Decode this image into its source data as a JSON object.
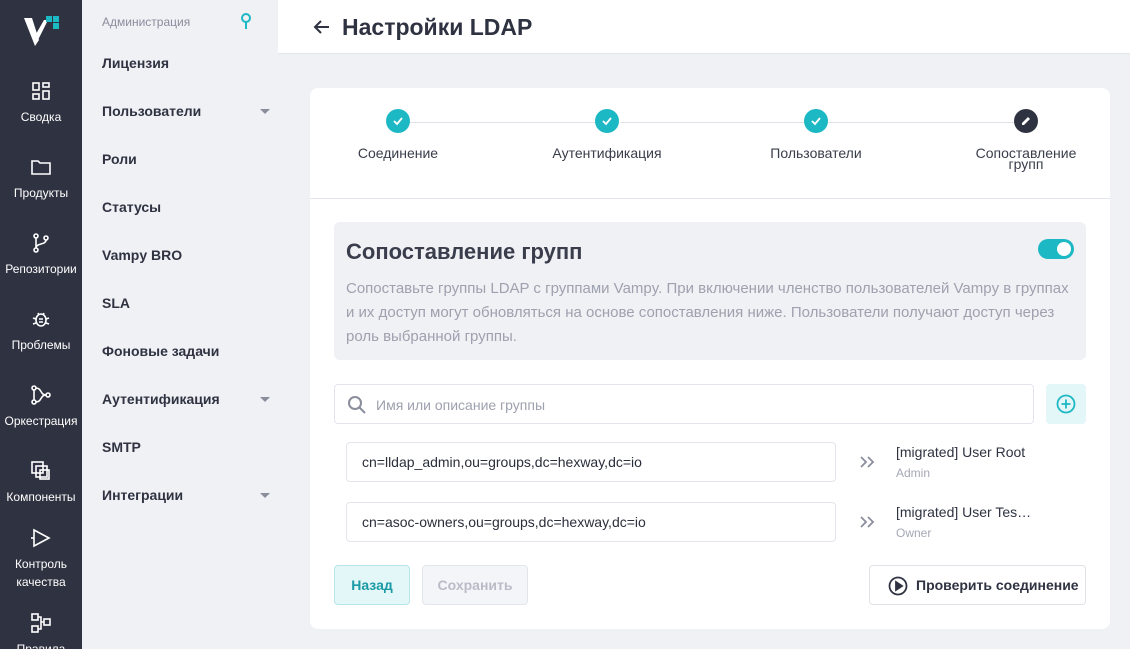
{
  "rail": {
    "items": [
      {
        "label": "Сводка",
        "icon": "dashboard-icon"
      },
      {
        "label": "Продукты",
        "icon": "folder-icon"
      },
      {
        "label": "Репозитории",
        "icon": "branch-icon"
      },
      {
        "label": "Проблемы",
        "icon": "bug-icon"
      },
      {
        "label": "Оркестрация",
        "icon": "orchestration-icon"
      },
      {
        "label": "Компоненты",
        "icon": "components-icon"
      },
      {
        "label": "Контроль",
        "label2": "качества",
        "icon": "quality-icon"
      },
      {
        "label": "Правила",
        "icon": "rules-icon"
      }
    ]
  },
  "sidebar": {
    "header": "Администрация",
    "items": [
      {
        "label": "Лицензия"
      },
      {
        "label": "Пользователи"
      },
      {
        "label": "Роли"
      },
      {
        "label": "Статусы"
      },
      {
        "label": "Vampy BRO"
      },
      {
        "label": "SLA"
      },
      {
        "label": "Фоновые задачи"
      },
      {
        "label": "Аутентификация"
      },
      {
        "label": "SMTP"
      },
      {
        "label": "Интеграции"
      }
    ]
  },
  "header": {
    "title": "Настройки LDAP"
  },
  "stepper": {
    "steps": [
      {
        "label": "Соединение",
        "state": "done"
      },
      {
        "label": "Аутентификация",
        "state": "done"
      },
      {
        "label": "Пользователи",
        "state": "done"
      },
      {
        "label": "Сопоставление",
        "label2": "групп",
        "state": "current"
      }
    ]
  },
  "info": {
    "title": "Сопоставление групп",
    "text": "Сопоставьте группы LDAP с группами Vampy. При включении членство пользователей Vampy в группах и их доступ могут обновляться на основе сопоставления ниже. Пользователи получают доступ через роль выбранной группы.",
    "enabled": true
  },
  "search": {
    "placeholder": "Имя или описание группы",
    "value": ""
  },
  "mappings": [
    {
      "dn": "cn=lldap_admin,ou=groups,dc=hexway,dc=io",
      "group": "[migrated] User Root",
      "role": "Admin"
    },
    {
      "dn": "cn=asoc-owners,ou=groups,dc=hexway,dc=io",
      "group": "[migrated] User Tes…",
      "role": "Owner"
    }
  ],
  "buttons": {
    "back": "Назад",
    "save": "Сохранить",
    "check": "Проверить соединение"
  },
  "colors": {
    "accent": "#1cb8c4",
    "rail_bg": "#2f3241",
    "page_bg": "#f0f1f5"
  }
}
